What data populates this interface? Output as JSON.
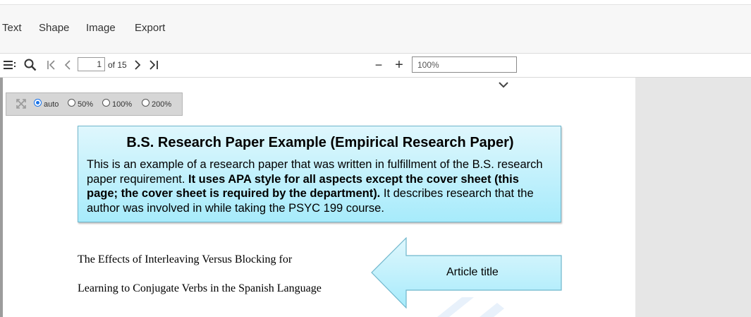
{
  "menubar": {
    "items": [
      "Text",
      "Shape",
      "Image",
      "Export"
    ]
  },
  "toolbar": {
    "icons": [
      "sidebar-toggle-icon",
      "search-icon",
      "first-page-icon",
      "previous-page-icon",
      "next-page-icon",
      "last-page-icon",
      "zoom-out-icon",
      "zoom-in-icon"
    ],
    "current_page": "1",
    "page_of": "of 15",
    "zoom_out_label": "−",
    "zoom_in_label": "+",
    "zoom_value": "100%"
  },
  "zoom_panel": {
    "fit_icon": "fit-screen-icon",
    "options": [
      {
        "label": "auto",
        "checked": true
      },
      {
        "label": "50%",
        "checked": false
      },
      {
        "label": "100%",
        "checked": false
      },
      {
        "label": "200%",
        "checked": false
      }
    ]
  },
  "callout": {
    "title": "B.S. Research Paper Example (Empirical Research Paper)",
    "body_part1": "This is an example of a research paper that was written in fulfillment of the B.S. research paper requirement.  ",
    "body_bold": "It uses APA style for all aspects except the cover sheet (this page; the cover sheet is required by the department).",
    "body_part2": "  It describes research that the author was involved in while taking the PSYC 199 course.",
    "colors": {
      "top": "#dff7fd",
      "bottom": "#a7ebfb",
      "border": "#6fb6cc"
    }
  },
  "document": {
    "line1": "The Effects of Interleaving Versus Blocking for",
    "line2": "Learning to Conjugate Verbs in the Spanish Language"
  },
  "arrow_callout": {
    "label": "Article title",
    "colors": {
      "top": "#dff7fd",
      "bottom": "#a7ebfb",
      "border": "#6fb6cc"
    }
  }
}
